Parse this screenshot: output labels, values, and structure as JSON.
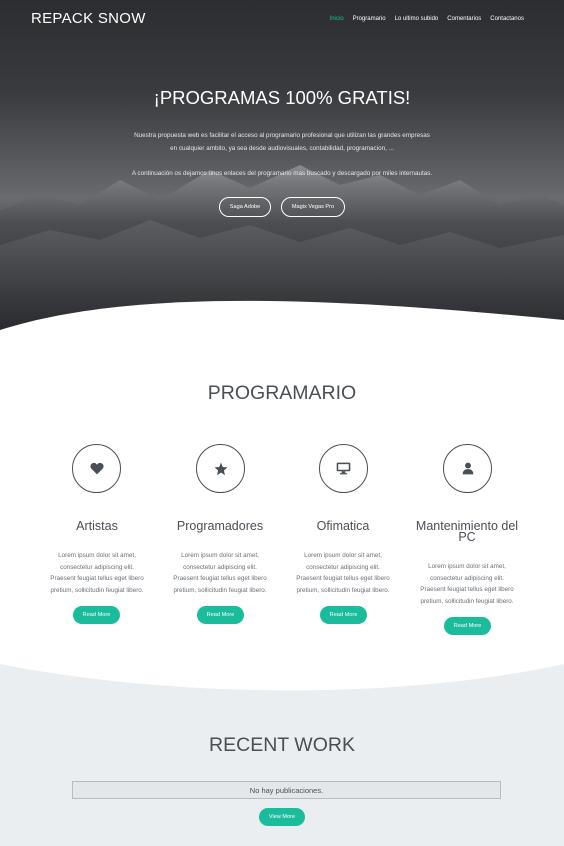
{
  "header": {
    "brand": "REPACK SNOW",
    "nav": [
      {
        "label": "Inicio",
        "active": true
      },
      {
        "label": "Programario"
      },
      {
        "label": "Lo ultimo subido"
      },
      {
        "label": "Comentarios"
      },
      {
        "label": "Contactanos"
      }
    ]
  },
  "hero": {
    "title": "¡PROGRAMAS 100% GRATIS!",
    "line1": "Nuestra propuesta web es facilitar el acceso al programario profesional que utilizan las grandes empresas",
    "line2": "en cualquier ambito, ya sea desde audiovisuales, contabilidad, programacion, ...",
    "line3": "A continuación os dejamos unos enlaces del programario mas buscado y descargado por miles internautas.",
    "buttons": [
      "Saga Adobe",
      "Magix Vegas Pro"
    ]
  },
  "programario": {
    "title": "PROGRAMARIO",
    "services": [
      {
        "icon": "heart-icon",
        "title": "Artistas",
        "text": [
          "Lorem ipsum dolor sit amet,",
          "consectetur adipiscing elit.",
          "Praesent feugiat tellus eget libero",
          "pretium, sollicitudin feugiat libero."
        ],
        "button": "Read More"
      },
      {
        "icon": "star-icon",
        "title": "Programadores",
        "text": [
          "Lorem ipsum dolor sit amet,",
          "consectetur adipiscing elit.",
          "Praesent feugiat tellus eget libero",
          "pretium, sollicitudin feugiat libero."
        ],
        "button": "Read More"
      },
      {
        "icon": "monitor-icon",
        "title": "Ofimatica",
        "text": [
          "Lorem ipsum dolor sit amet,",
          "consectetur adipiscing elit.",
          "Praesent feugiat tellus eget libero",
          "pretium, sollicitudin feugiat libero."
        ],
        "button": "Read More"
      },
      {
        "icon": "user-icon",
        "title_line1": "Mantenimiento del",
        "title_line2": "PC",
        "text": [
          "Lorem ipsum dolor sit amet,",
          "consectetur adipiscing elit.",
          "Praesent feugiat tellus eget libero",
          "pretium, sollicitudin feugiat libero."
        ],
        "button": "Read More"
      }
    ]
  },
  "recent": {
    "title": "RECENT WORK",
    "empty_message": "No hay publicaciones.",
    "button": "View More"
  },
  "colors": {
    "accent": "#1abc9c",
    "text": "#4a4f55",
    "grey_bg": "#ebeef0"
  }
}
